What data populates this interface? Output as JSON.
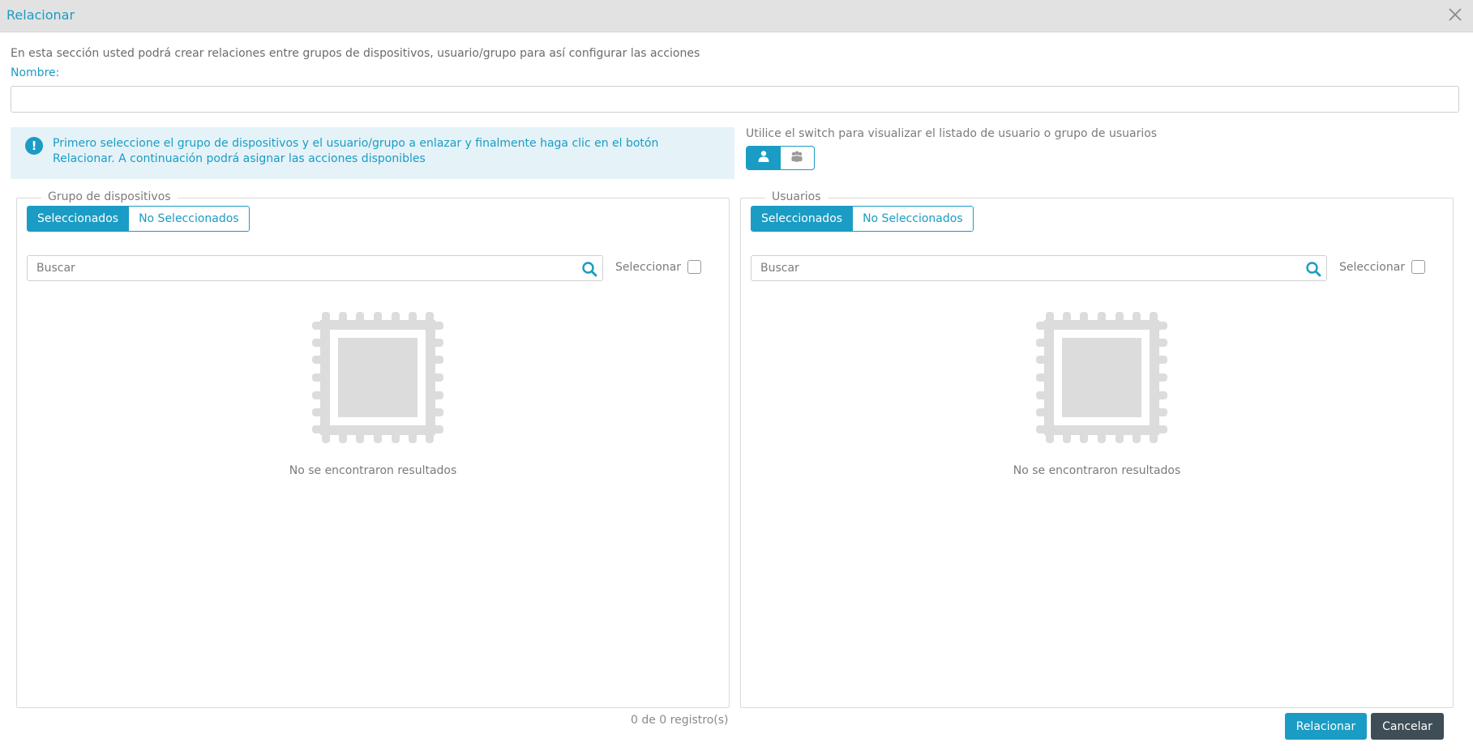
{
  "dialog": {
    "title": "Relacionar",
    "intro": "En esta sección usted podrá crear relaciones entre grupos de dispositivos, usuario/grupo para así configurar las acciones",
    "name_label": "Nombre:",
    "name_value": "",
    "info_message": "Primero seleccione el grupo de dispositivos y el usuario/grupo a enlazar y finalmente haga clic en el botón Relacionar. A continuación podrá asignar las acciones disponibles",
    "switch_hint": "Utilice el switch para visualizar el listado de usuario o grupo de usuarios",
    "switch_options": [
      {
        "icon": "user-icon",
        "active": true
      },
      {
        "icon": "users-group-icon",
        "active": false
      }
    ]
  },
  "devices_panel": {
    "legend": "Grupo de dispositivos",
    "tabs": [
      {
        "label": "Seleccionados",
        "active": true
      },
      {
        "label": "No Seleccionados",
        "active": false
      }
    ],
    "search_placeholder": "Buscar",
    "select_label": "Seleccionar",
    "empty_icon": "empty-results-icon",
    "empty_text": "No se encontraron resultados"
  },
  "users_panel": {
    "legend": "Usuarios",
    "tabs": [
      {
        "label": "Seleccionados",
        "active": true
      },
      {
        "label": "No Seleccionados",
        "active": false
      }
    ],
    "search_placeholder": "Buscar",
    "select_label": "Seleccionar",
    "empty_icon": "empty-results-icon",
    "empty_text": "No se encontraron resultados"
  },
  "footer": {
    "records": "0 de 0 registro(s)",
    "relate_button": "Relacionar",
    "cancel_button": "Cancelar"
  },
  "colors": {
    "accent": "#1a9cc4",
    "info_bg": "#e5f3f8",
    "titlebar_bg": "#e2e2e2",
    "cancel_bg": "#3f4d56",
    "empty_icon": "#dcdcdc"
  }
}
